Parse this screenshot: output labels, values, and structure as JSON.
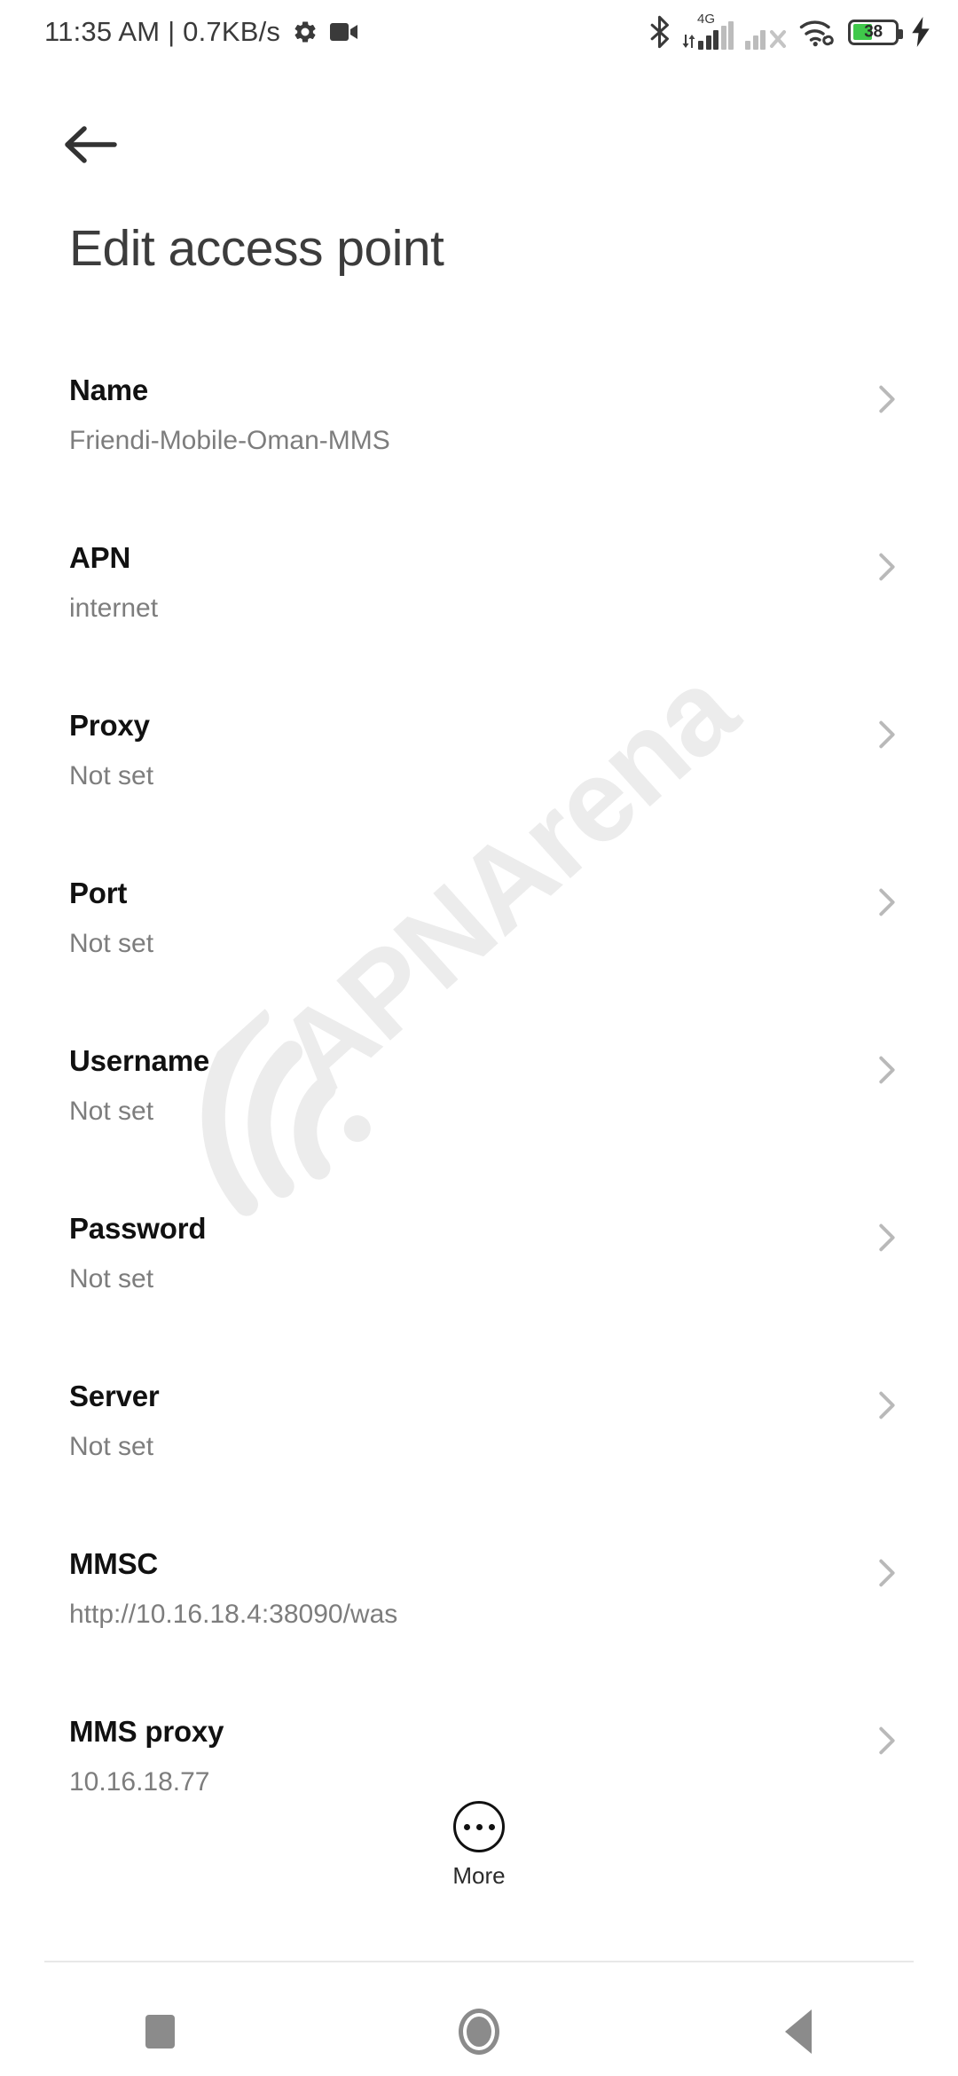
{
  "statusbar": {
    "clock": "11:35 AM | 0.7KB/s",
    "gear_icon": "gear-icon",
    "camera_icon": "video-camera-icon",
    "bluetooth_icon": "bluetooth-icon",
    "network_type": "4G",
    "sim1_icon": "signal-bars-icon",
    "sim2_icon": "signal-no-service-icon",
    "wifi_icon": "wifi-link-icon",
    "battery_level": "38",
    "battery_charging_icon": "charging-bolt-icon",
    "battery_color": "#3fc84a"
  },
  "header": {
    "back_icon": "back-arrow-icon",
    "title": "Edit access point"
  },
  "watermark": {
    "text": "APNArena",
    "logo_icon": "wifi-arc-icon",
    "color": "#ececec"
  },
  "list": {
    "chevron_icon": "chevron-right-icon",
    "rows": [
      {
        "title": "Name",
        "value": "Friendi-Mobile-Oman-MMS"
      },
      {
        "title": "APN",
        "value": "internet"
      },
      {
        "title": "Proxy",
        "value": "Not set"
      },
      {
        "title": "Port",
        "value": "Not set"
      },
      {
        "title": "Username",
        "value": "Not set"
      },
      {
        "title": "Password",
        "value": "Not set"
      },
      {
        "title": "Server",
        "value": "Not set"
      },
      {
        "title": "MMSC",
        "value": "http://10.16.18.4:38090/was"
      },
      {
        "title": "MMS proxy",
        "value": "10.16.18.77"
      }
    ]
  },
  "more": {
    "label": "More",
    "icon": "more-dots-circle-icon"
  },
  "navbar": {
    "recents_icon": "recents-square-icon",
    "home_icon": "home-circle-icon",
    "back_icon": "back-triangle-icon"
  }
}
